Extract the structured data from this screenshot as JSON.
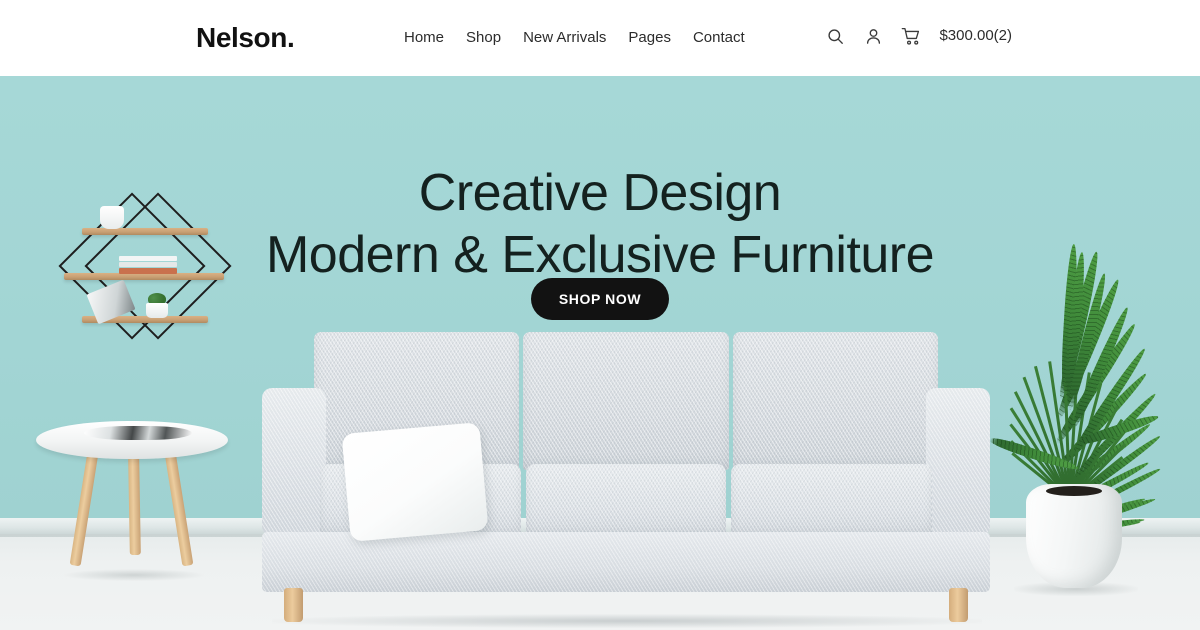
{
  "header": {
    "logo": "Nelson.",
    "nav": [
      {
        "label": "Home"
      },
      {
        "label": "Shop"
      },
      {
        "label": "New Arrivals"
      },
      {
        "label": "Pages"
      },
      {
        "label": "Contact"
      }
    ],
    "icons": {
      "search": "search-icon",
      "account": "user-icon",
      "cart": "shopping-cart-icon"
    },
    "cart_total": "$300.00(2)",
    "background_color": "#ffffff",
    "text_color": "#2c2c2c"
  },
  "hero": {
    "title_line1": "Creative Design",
    "title_line2": "Modern & Exclusive Furniture",
    "cta_label": "SHOP NOW",
    "cta_background": "#121212",
    "cta_text_color": "#ffffff",
    "wall_color": "#a3d6d5",
    "floor_color": "#eef1f1",
    "title_color": "#14211f",
    "scene": {
      "wall_shelf": "geometric-diamond-wall-shelf",
      "shelf_items": [
        "white-vase",
        "stacked-books",
        "magazine",
        "potted-cactus"
      ],
      "side_table": "round-white-three-leg-side-table",
      "side_table_items": [
        "magazines"
      ],
      "sofa": "three-seat-light-grey-fabric-sofa",
      "sofa_accessories": [
        "white-throw-pillow"
      ],
      "plant": "potted-kentia-palm",
      "plant_pot": "white-ceramic-pot"
    }
  }
}
